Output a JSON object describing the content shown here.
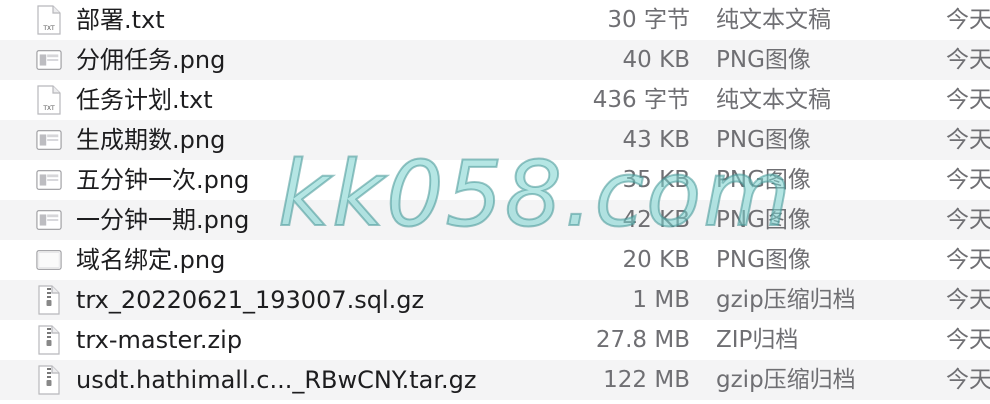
{
  "files": [
    {
      "name": "部署.txt",
      "size": "30 字节",
      "kind": "纯文本文稿",
      "date": "今天",
      "icon": "text-file-icon"
    },
    {
      "name": "分佣任务.png",
      "size": "40 KB",
      "kind": "PNG图像",
      "date": "今天",
      "icon": "image-file-icon"
    },
    {
      "name": "任务计划.txt",
      "size": "436 字节",
      "kind": "纯文本文稿",
      "date": "今天",
      "icon": "text-file-icon"
    },
    {
      "name": "生成期数.png",
      "size": "43 KB",
      "kind": "PNG图像",
      "date": "今天",
      "icon": "image-file-icon"
    },
    {
      "name": "五分钟一次.png",
      "size": "35 KB",
      "kind": "PNG图像",
      "date": "今天",
      "icon": "image-file-icon"
    },
    {
      "name": "一分钟一期.png",
      "size": "42 KB",
      "kind": "PNG图像",
      "date": "今天",
      "icon": "image-file-icon"
    },
    {
      "name": "域名绑定.png",
      "size": "20 KB",
      "kind": "PNG图像",
      "date": "今天",
      "icon": "blank-image-file-icon"
    },
    {
      "name": "trx_20220621_193007.sql.gz",
      "size": "1 MB",
      "kind": "gzip压缩归档",
      "date": "今天",
      "icon": "archive-file-icon"
    },
    {
      "name": "trx-master.zip",
      "size": "27.8 MB",
      "kind": "ZIP归档",
      "date": "今天",
      "icon": "archive-file-icon"
    },
    {
      "name": "usdt.hathimall.c..._RBwCNY.tar.gz",
      "size": "122 MB",
      "kind": "gzip压缩归档",
      "date": "今天",
      "icon": "archive-file-icon"
    }
  ],
  "txt_badge": "TXT",
  "watermark": "kk058.com",
  "colors": {
    "alt_row": "#f4f4f5",
    "text": "#1d1d1f",
    "secondary": "#6f6f73",
    "watermark": "#78d2cd"
  }
}
